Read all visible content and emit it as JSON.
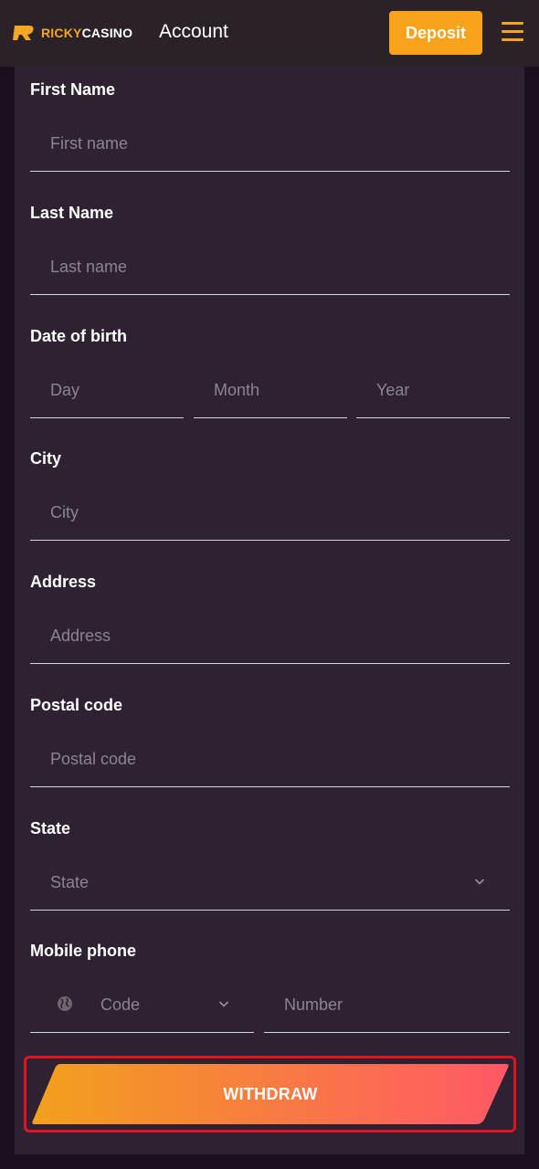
{
  "header": {
    "logo_ricky": "RICKY",
    "logo_casino": "CASINO",
    "title": "Account",
    "deposit_label": "Deposit",
    "menu_icon": "hamburger-menu-icon"
  },
  "form": {
    "first_name": {
      "label": "First Name",
      "placeholder": "First name"
    },
    "last_name": {
      "label": "Last Name",
      "placeholder": "Last name"
    },
    "dob": {
      "label": "Date of birth",
      "day": "Day",
      "month": "Month",
      "year": "Year"
    },
    "city": {
      "label": "City",
      "placeholder": "City"
    },
    "address": {
      "label": "Address",
      "placeholder": "Address"
    },
    "postal_code": {
      "label": "Postal code",
      "placeholder": "Postal code"
    },
    "state": {
      "label": "State",
      "placeholder": "State"
    },
    "mobile": {
      "label": "Mobile phone",
      "code": "Code",
      "number": "Number"
    },
    "withdraw_label": "WITHDRAW"
  },
  "colors": {
    "accent": "#f9a31b",
    "panel": "#2e2131",
    "header": "#2a2228",
    "button_gradient_start": "#f2a01d",
    "button_gradient_end": "#ff5866",
    "highlight_border": "#e0141e"
  }
}
